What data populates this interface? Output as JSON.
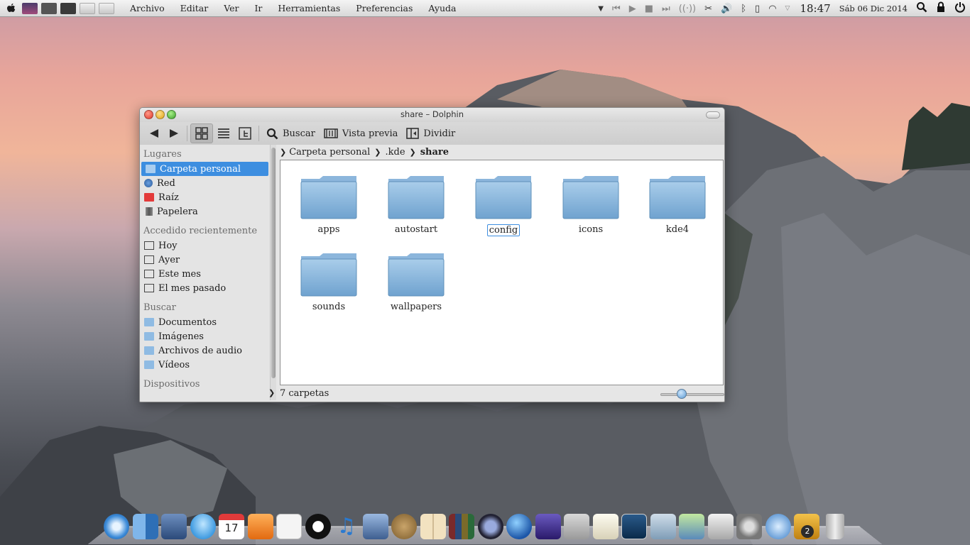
{
  "menubar": {
    "menus": [
      "Archivo",
      "Editar",
      "Ver",
      "Ir",
      "Herramientas",
      "Preferencias",
      "Ayuda"
    ],
    "clock": "18:47",
    "date": "Sáb 06 Dic 2014"
  },
  "window": {
    "title": "share – Dolphin",
    "toolbar": {
      "search_label": "Buscar",
      "preview_label": "Vista previa",
      "split_label": "Dividir"
    },
    "sidebar": {
      "places_heading": "Lugares",
      "places": [
        "Carpeta personal",
        "Red",
        "Raíz",
        "Papelera"
      ],
      "recent_heading": "Accedido recientemente",
      "recent": [
        "Hoy",
        "Ayer",
        "Este mes",
        "El mes pasado"
      ],
      "search_heading": "Buscar",
      "search": [
        "Documentos",
        "Imágenes",
        "Archivos de audio",
        "Vídeos"
      ],
      "devices_heading": "Dispositivos"
    },
    "breadcrumb": [
      "Carpeta personal",
      ".kde",
      "share"
    ],
    "folders": [
      "apps",
      "autostart",
      "config",
      "icons",
      "kde4",
      "sounds",
      "wallpapers"
    ],
    "selected_folder": "config",
    "status_text": "7 carpetas"
  },
  "dock": {
    "calendar_day": "17",
    "badge_count": "2"
  },
  "colors": {
    "selection": "#3d8ee0",
    "folder": "#7fb0d8"
  }
}
